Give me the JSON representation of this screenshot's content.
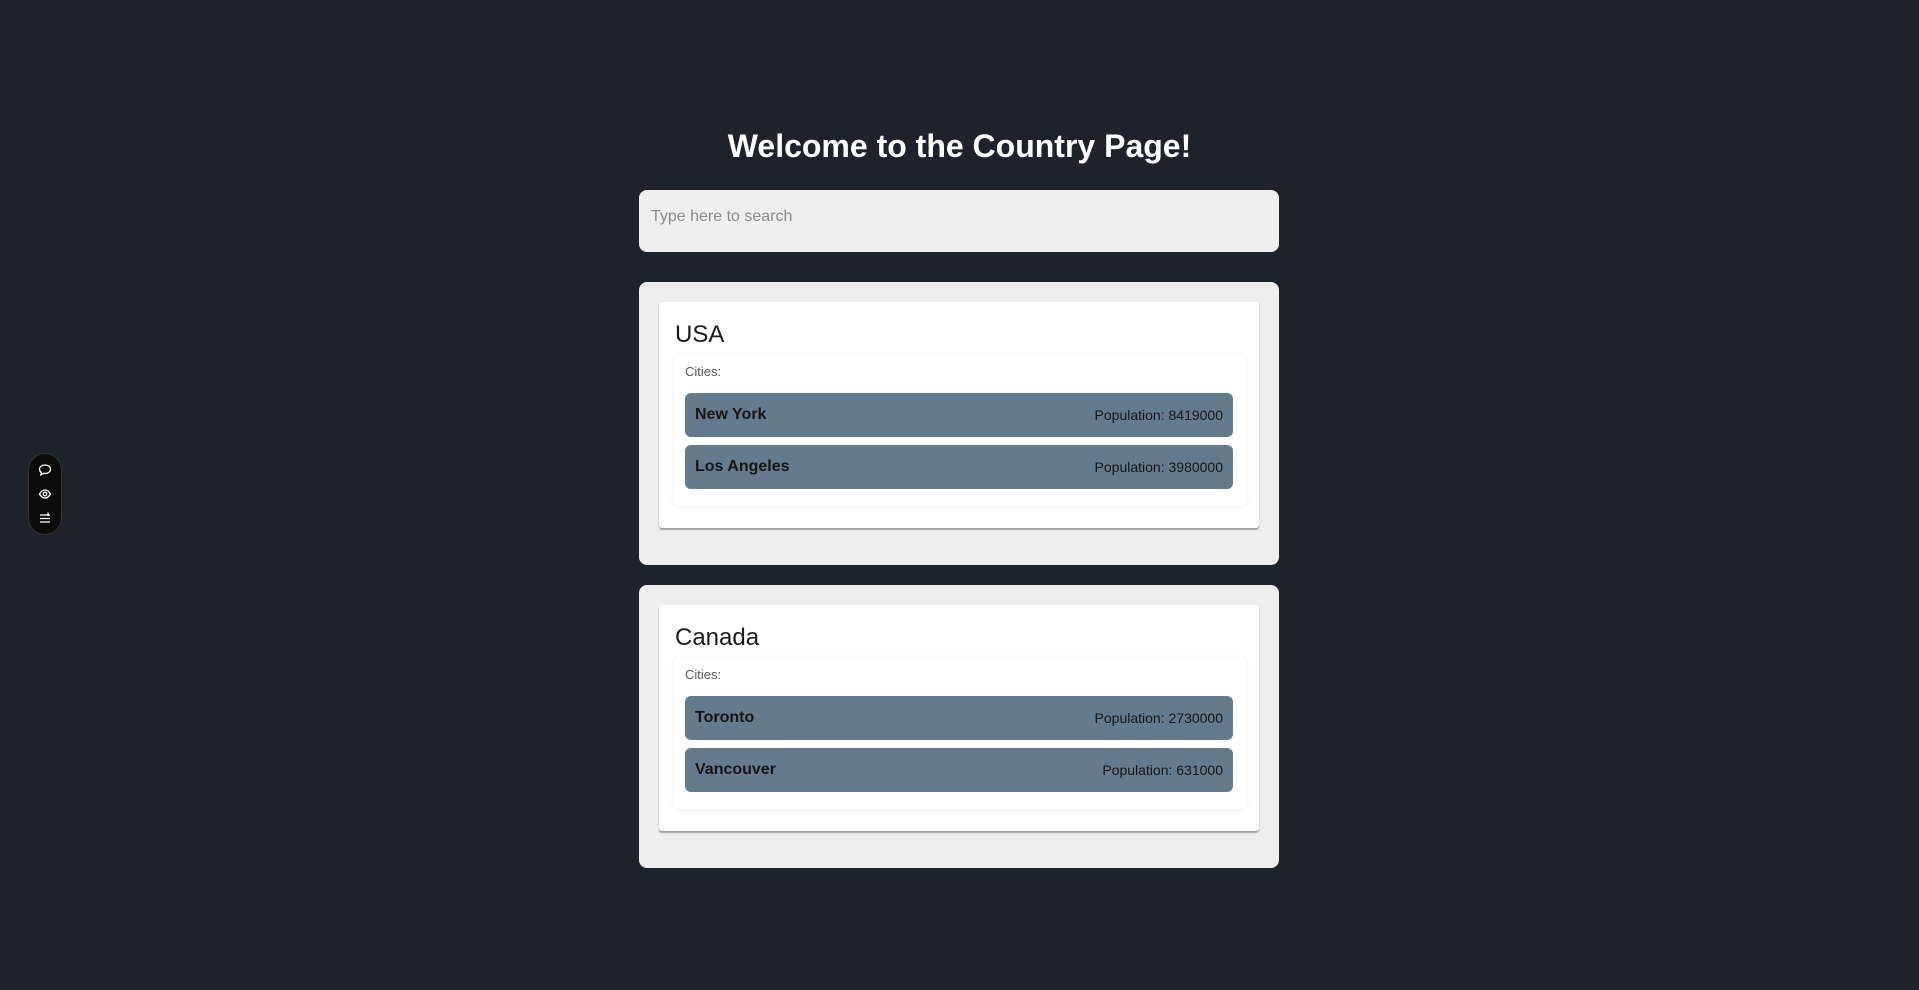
{
  "header": {
    "title": "Welcome to the Country Page!"
  },
  "search": {
    "placeholder": "Type here to search",
    "value": ""
  },
  "countries": [
    {
      "name": "USA",
      "cities_label": "Cities:",
      "cities": [
        {
          "name": "New York",
          "population": "Population: 8419000"
        },
        {
          "name": "Los Angeles",
          "population": "Population: 3980000"
        }
      ]
    },
    {
      "name": "Canada",
      "cities_label": "Cities:",
      "cities": [
        {
          "name": "Toronto",
          "population": "Population: 2730000"
        },
        {
          "name": "Vancouver",
          "population": "Population: 631000"
        }
      ]
    }
  ],
  "toolbar": {
    "icons": [
      "chat-bubble-icon",
      "eye-icon",
      "sliders-icon"
    ]
  },
  "colors": {
    "background": "#1e232b",
    "panel": "#eeeeee",
    "city_row": "#657a8c"
  }
}
